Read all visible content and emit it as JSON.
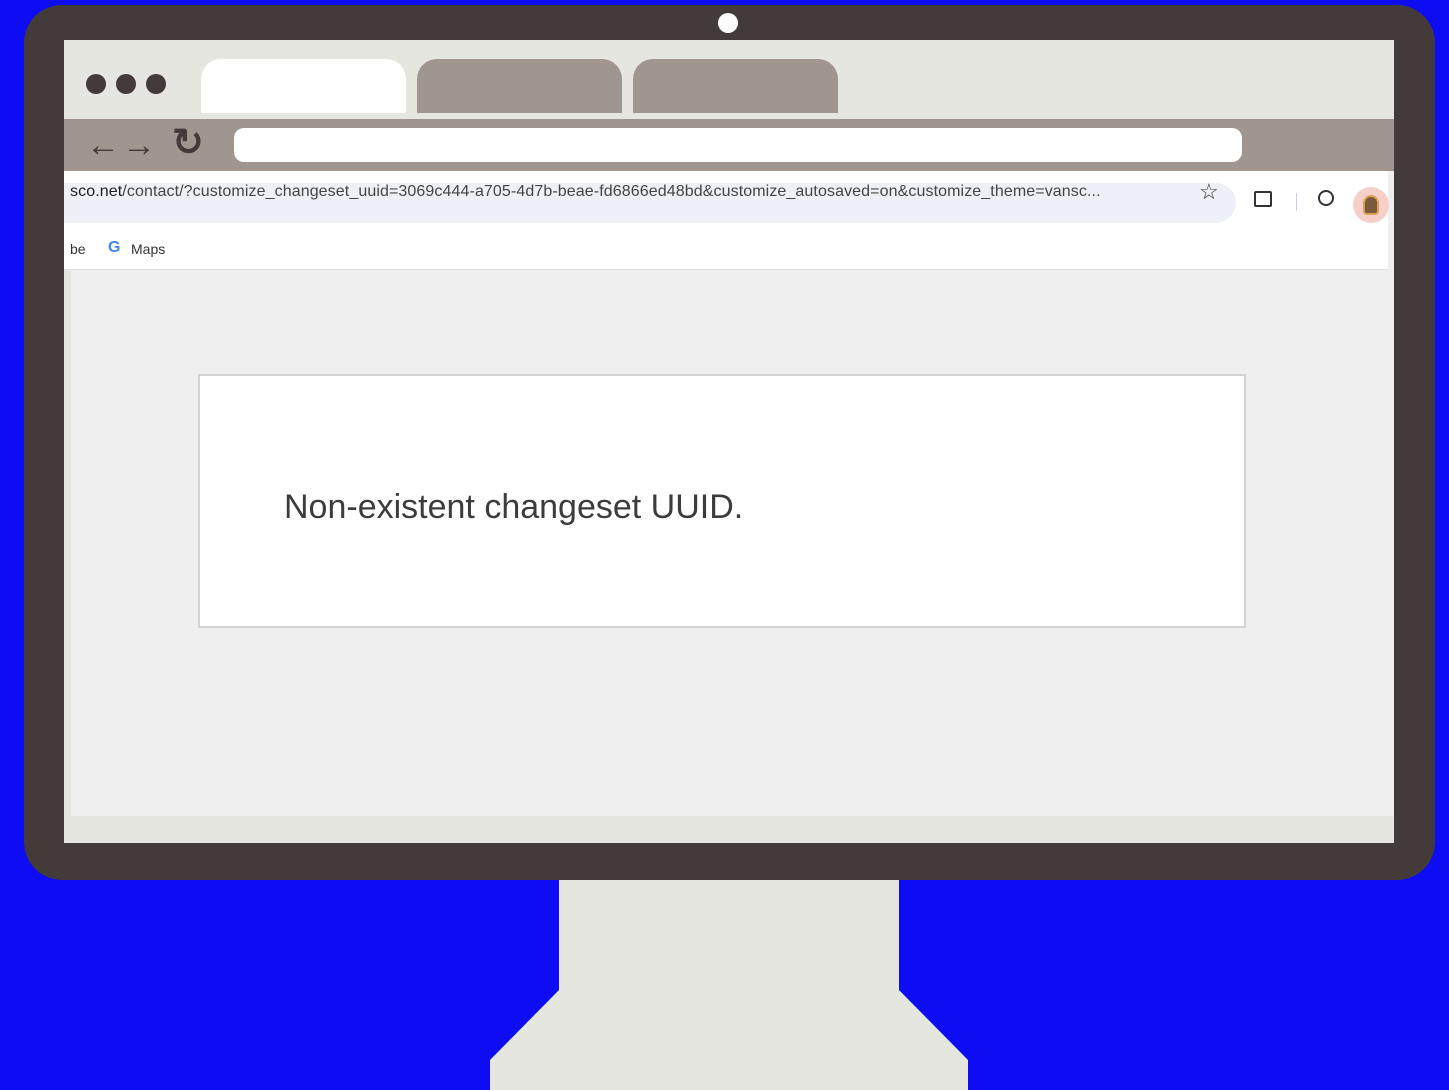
{
  "browser": {
    "address": {
      "host": "sco.net",
      "path": "/contact/?customize_changeset_uuid=3069c444-a705-4d7b-beae-fd6866ed48bd&customize_autosaved=on&customize_theme=vansc..."
    },
    "bookmarks": [
      {
        "label": "be"
      },
      {
        "label": "Maps",
        "icon": "google-g-icon"
      }
    ]
  },
  "page": {
    "message": "Non-existent changeset UUID."
  },
  "icons": {
    "back": "←",
    "forward": "→",
    "reload": "↻",
    "star": "☆",
    "google": "G"
  },
  "colors": {
    "background": "#0d0cf2",
    "monitor_frame": "#433a3a",
    "screen": "#e6e6e0",
    "toolbar": "#a09690",
    "tab_active": "#ffffff"
  }
}
